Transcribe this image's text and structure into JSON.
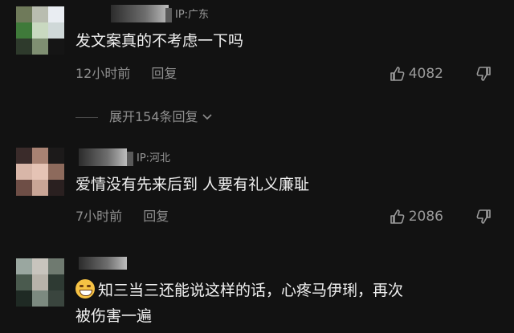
{
  "comments": [
    {
      "ip": "IP:广东",
      "text": "发文案真的不考虑一下吗",
      "time": "12小时前",
      "reply": "回复",
      "likes": "4082",
      "avatar_colors": [
        "#6f7a5a",
        "#b9bdb0",
        "#e9edf2",
        "#3f7a3a",
        "#c9d9c0",
        "#cfd8d8",
        "#2e3a2c",
        "#7f8f72",
        "#151515"
      ]
    },
    {
      "ip": "IP:河北",
      "text": "爱情没有先来后到 人要有礼义廉耻",
      "time": "7小时前",
      "reply": "回复",
      "likes": "2086",
      "avatar_colors": [
        "#3a2b2a",
        "#a88273",
        "#1c1a1a",
        "#d8b6a8",
        "#e5c3b5",
        "#8d6a5c",
        "#6e4e46",
        "#c9a596",
        "#2a2020"
      ]
    },
    {
      "text": "知三当三还能说这样的话，心疼马伊琍，再次被伤害一遍",
      "text_line1": "知三当三还能说这样的话，心疼马伊琍，再次",
      "text_line2": "被伤害一遍",
      "avatar_colors": [
        "#9aa7a0",
        "#c8c4bd",
        "#6f7a70",
        "#4a5a4e",
        "#b8b3aa",
        "#2e3a33",
        "#1f2a24",
        "#7c8a80",
        "#3a453e"
      ]
    }
  ],
  "expand_replies": "展开154条回复",
  "icons": {
    "like": "thumbs-up-icon",
    "dislike": "thumbs-down-icon",
    "expand": "chevron-down-icon",
    "emoji": "grinning-sweat-emoji-icon"
  }
}
